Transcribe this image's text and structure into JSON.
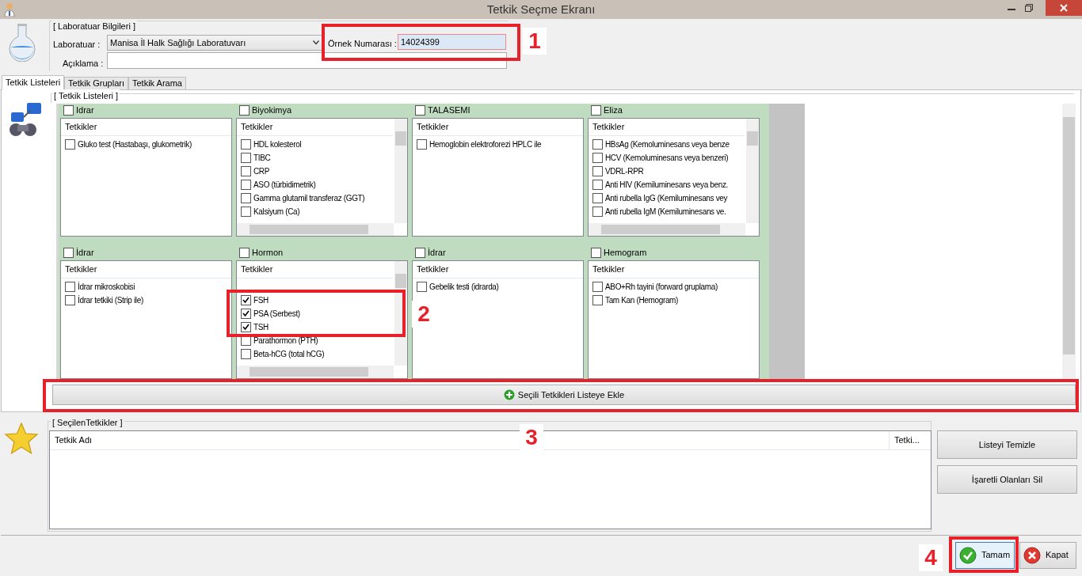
{
  "window": {
    "title": "Tetkik Seçme Ekranı"
  },
  "lab_info": {
    "group_title": "[ Laboratuar Bilgileri ]",
    "lab_label": "Laboratuar :",
    "lab_value": "Manisa İl Halk Sağlığı Laboratuvarı",
    "note_label": "Açıklama :",
    "sample_label": "Örnek Numarası :",
    "sample_value": "14024399"
  },
  "tabs": [
    {
      "label": "Tetkik Listeleri",
      "selected": true
    },
    {
      "label": "Tetkik Grupları",
      "selected": false
    },
    {
      "label": "Tetkik Arama",
      "selected": false
    }
  ],
  "test_lists": {
    "group_title": "[ Tetkik Listeleri ]",
    "panels": [
      {
        "title": "Idrar",
        "checked": false,
        "column": "Tetkikler",
        "scrollable": false,
        "items": [
          {
            "label": "Gluko test (Hastabaşı, glukometrik)",
            "checked": false
          }
        ]
      },
      {
        "title": "Biyokimya",
        "checked": false,
        "column": "Tetkikler",
        "scrollable": true,
        "items": [
          {
            "label": "HDL kolesterol",
            "checked": false
          },
          {
            "label": "TIBC",
            "checked": false
          },
          {
            "label": "CRP",
            "checked": false
          },
          {
            "label": "ASO (türbidimetrik)",
            "checked": false
          },
          {
            "label": "Gamma glutamil transferaz (GGT)",
            "checked": false
          },
          {
            "label": "Kalsiyum (Ca)",
            "checked": false
          }
        ]
      },
      {
        "title": "TALASEMI",
        "checked": false,
        "column": "Tetkikler",
        "scrollable": false,
        "items": [
          {
            "label": "Hemoglobin elektroforezi  HPLC ile",
            "checked": false
          }
        ]
      },
      {
        "title": "Eliza",
        "checked": false,
        "column": "Tetkikler",
        "scrollable": true,
        "items": [
          {
            "label": "HBsAg (Kemoluminesans veya benze",
            "checked": false
          },
          {
            "label": "HCV (Kemoluminesans veya benzeri)",
            "checked": false
          },
          {
            "label": "VDRL-RPR",
            "checked": false
          },
          {
            "label": "Anti HIV (Kemiluminesans veya benz.",
            "checked": false
          },
          {
            "label": "Anti rubella IgG (Kemiluminesans vey",
            "checked": false
          },
          {
            "label": "Anti rubella IgM (Kemiluminesans ve.",
            "checked": false
          }
        ]
      },
      {
        "title": "İdrar",
        "checked": false,
        "column": "Tetkikler",
        "scrollable": false,
        "items": [
          {
            "label": "İdrar mikroskobisi",
            "checked": false
          },
          {
            "label": "İdrar tetkiki (Strip ile)",
            "checked": false
          }
        ]
      },
      {
        "title": "Hormon",
        "checked": false,
        "column": "Tetkikler",
        "scrollable": true,
        "items": [
          {
            "label": "FSH",
            "checked": true
          },
          {
            "label": "PSA (Serbest)",
            "checked": true
          },
          {
            "label": "TSH",
            "checked": true
          },
          {
            "label": "Parathormon (PTH)",
            "checked": false
          },
          {
            "label": "Beta-hCG (total hCG)",
            "checked": false
          }
        ]
      },
      {
        "title": "İdrar",
        "checked": false,
        "column": "Tetkikler",
        "scrollable": false,
        "items": [
          {
            "label": "Gebelik testi (idrarda)",
            "checked": false
          }
        ]
      },
      {
        "title": "Hemogram",
        "checked": false,
        "column": "Tetkikler",
        "scrollable": false,
        "items": [
          {
            "label": "ABO+Rh tayini (forward gruplama)",
            "checked": false
          },
          {
            "label": "Tam Kan (Hemogram)",
            "checked": false
          }
        ]
      }
    ]
  },
  "add_button": "Seçili Tetkikleri Listeye Ekle",
  "selected_tests": {
    "group_title": "[ SeçilenTetkikler ]",
    "columns": [
      "Tetkik Adı",
      "Tetki..."
    ],
    "buttons": [
      "Listeyi Temizle",
      "İşaretli Olanları Sil"
    ]
  },
  "footer_buttons": [
    {
      "label": "Tamam",
      "kind": "ok"
    },
    {
      "label": "Kapat",
      "kind": "close"
    }
  ],
  "callouts": [
    {
      "label": "1"
    },
    {
      "label": "2"
    },
    {
      "label": "3"
    },
    {
      "label": "4"
    }
  ]
}
